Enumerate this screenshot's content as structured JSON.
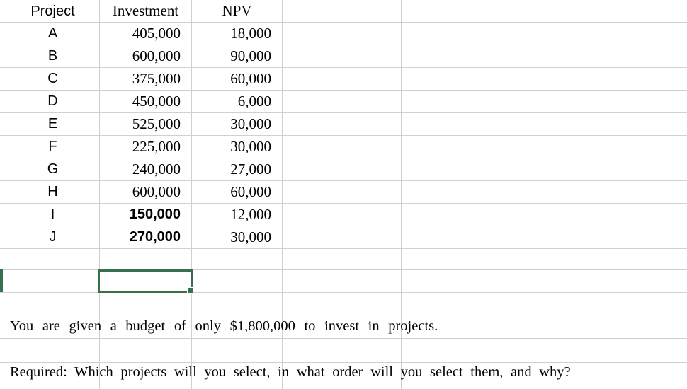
{
  "app": {
    "kind": "spreadsheet",
    "accent_selection_color": "#37704c",
    "gridline_color": "#d0d0d0"
  },
  "table": {
    "headers": [
      "Project",
      "Investment",
      "NPV"
    ],
    "rows": [
      {
        "project": "A",
        "investment": "405,000",
        "npv": "18,000",
        "investment_bold": false
      },
      {
        "project": "B",
        "investment": "600,000",
        "npv": "90,000",
        "investment_bold": false
      },
      {
        "project": "C",
        "investment": "375,000",
        "npv": "60,000",
        "investment_bold": false
      },
      {
        "project": "D",
        "investment": "450,000",
        "npv": "6,000",
        "investment_bold": false
      },
      {
        "project": "E",
        "investment": "525,000",
        "npv": "30,000",
        "investment_bold": false
      },
      {
        "project": "F",
        "investment": "225,000",
        "npv": "30,000",
        "investment_bold": false
      },
      {
        "project": "G",
        "investment": "240,000",
        "npv": "27,000",
        "investment_bold": false
      },
      {
        "project": "H",
        "investment": "600,000",
        "npv": "60,000",
        "investment_bold": false
      },
      {
        "project": "I",
        "investment": "150,000",
        "npv": "12,000",
        "investment_bold": true
      },
      {
        "project": "J",
        "investment": "270,000",
        "npv": "30,000",
        "investment_bold": true
      }
    ]
  },
  "prose": {
    "budget_statement": "You are given a budget of only $1,800,000 to invest in projects.",
    "budget_words": [
      "You",
      "are",
      "given",
      "a",
      "budget",
      "of",
      "only",
      "$1,800,000",
      "to",
      "invest",
      "in",
      "projects."
    ],
    "required_statement": "Required: Which projects will you select, in what order will you select them, and why?",
    "required_words": [
      "Required:",
      "Which",
      "projects",
      "will",
      "you",
      "select,",
      "in",
      "what",
      "order",
      "will",
      "you",
      "select",
      "them,",
      "and",
      "why?"
    ]
  },
  "selection": {
    "label": "active-cell",
    "column": "Investment",
    "fill_handle": true
  },
  "chart_data": {
    "type": "table",
    "title": "Project Investment and NPV",
    "columns": [
      "Project",
      "Investment",
      "NPV"
    ],
    "categories": [
      "A",
      "B",
      "C",
      "D",
      "E",
      "F",
      "G",
      "H",
      "I",
      "J"
    ],
    "series": [
      {
        "name": "Investment",
        "values": [
          405000,
          600000,
          375000,
          450000,
          525000,
          225000,
          240000,
          600000,
          150000,
          270000
        ]
      },
      {
        "name": "NPV",
        "values": [
          18000,
          90000,
          60000,
          6000,
          30000,
          30000,
          27000,
          60000,
          12000,
          30000
        ]
      }
    ],
    "annotations": [
      "You are given a budget of only $1,800,000 to invest in projects.",
      "Required: Which projects will you select, in what order will you select them, and why?"
    ],
    "budget": 1800000
  }
}
